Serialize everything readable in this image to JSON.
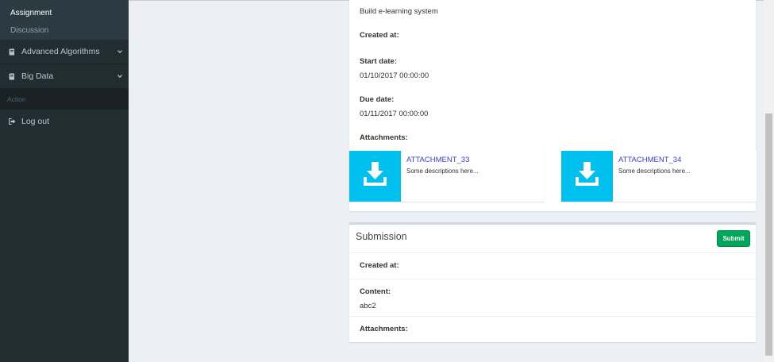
{
  "sidebar": {
    "sub_items": [
      {
        "label": "Assignment",
        "active": true
      },
      {
        "label": "Discussion",
        "active": false
      }
    ],
    "menu_items": [
      {
        "label": "Advanced Algorithms",
        "icon": "book-icon"
      },
      {
        "label": "Big Data",
        "icon": "book-icon"
      }
    ],
    "header": "Action",
    "logout_label": "Log out"
  },
  "assignment": {
    "description": "Build e-learning system",
    "created_at_label": "Created at:",
    "start_date_label": "Start date:",
    "start_date": "01/10/2017 00:00:00",
    "due_date_label": "Due date:",
    "due_date": "01/11/2017 00:00:00",
    "attachments_label": "Attachments:",
    "attachments": [
      {
        "title": "ATTACHMENT_33",
        "description": "Some descriptions here..."
      },
      {
        "title": "ATTACHMENT_34",
        "description": "Some descriptions here..."
      }
    ]
  },
  "submission": {
    "title": "Submission",
    "submit_label": "Submit",
    "created_at_label": "Created at:",
    "content_label": "Content:",
    "content": "abc2",
    "attachments_label": "Attachments:"
  },
  "colors": {
    "sidebar_bg": "#222d32",
    "attachment_icon_bg": "#00c0ef",
    "submit_bg": "#00a65a",
    "link": "#3c3cd8"
  }
}
